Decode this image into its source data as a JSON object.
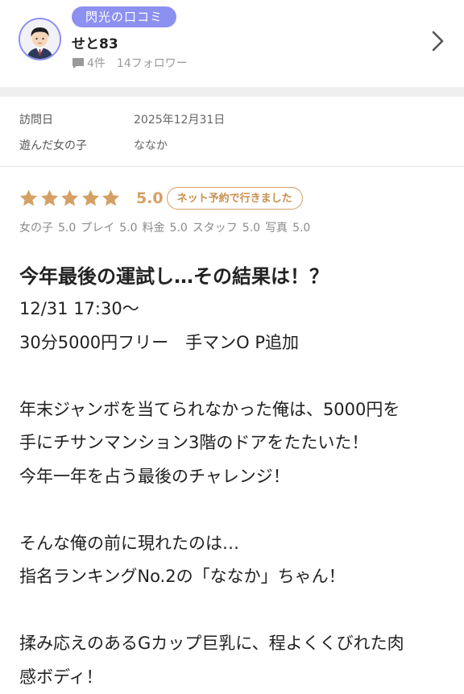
{
  "user": {
    "badge": "閃光の口コミ",
    "name": "せと83",
    "review_count": "4件",
    "followers": "14フォロワー"
  },
  "visit": {
    "date_label": "訪問日",
    "date_value": "2025年12月31日",
    "girl_label": "遊んだ女の子",
    "girl_value": "ななか"
  },
  "rating": {
    "stars": 5,
    "score": "5.0",
    "booking_badge": "ネット予約で行きました",
    "sub": [
      {
        "label": "女の子",
        "value": "5.0"
      },
      {
        "label": "プレイ",
        "value": "5.0"
      },
      {
        "label": "料金",
        "value": "5.0"
      },
      {
        "label": "スタッフ",
        "value": "5.0"
      },
      {
        "label": "写真",
        "value": "5.0"
      }
    ]
  },
  "review": {
    "title": "今年最後の運試し…その結果は！？",
    "lines": [
      "12/31 17:30〜",
      "30分5000円フリー　手マンO P追加",
      "",
      "年末ジャンボを当てられなかった俺は、5000円を",
      "手にチサンマンション3階のドアをたたいた！",
      "今年一年を占う最後のチャレンジ！",
      "",
      "そんな俺の前に現れたのは…",
      "指名ランキングNo.2の「ななか」ちゃん！",
      "",
      "揉み応えのあるGカップ巨乳に、程よくくびれた肉",
      "感ボディ！"
    ]
  },
  "colors": {
    "badge": "#8c90f0",
    "accent_gold": "#d4a064"
  }
}
